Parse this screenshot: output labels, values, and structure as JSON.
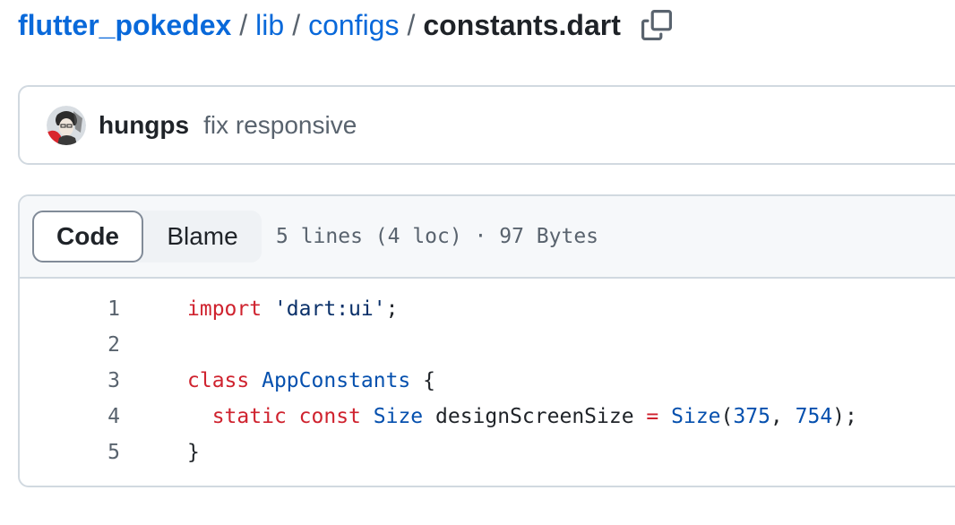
{
  "breadcrumb": {
    "repo": "flutter_pokedex",
    "sep": "/",
    "dir1": "lib",
    "dir2": "configs",
    "file": "constants.dart"
  },
  "icons": {
    "copy_path": "copy-icon",
    "avatar": "avatar-image"
  },
  "commit": {
    "author": "hungps",
    "message": "fix responsive"
  },
  "file_header": {
    "tabs": [
      {
        "label": "Code",
        "active": true
      },
      {
        "label": "Blame",
        "active": false
      }
    ],
    "meta": "5 lines (4 loc) · 97 Bytes"
  },
  "code": {
    "lines": [
      {
        "num": "1",
        "tokens": [
          {
            "t": "import",
            "c": "k"
          },
          {
            "t": " ",
            "c": "p"
          },
          {
            "t": "'dart:ui'",
            "c": "s"
          },
          {
            "t": ";",
            "c": "p"
          }
        ]
      },
      {
        "num": "2",
        "tokens": []
      },
      {
        "num": "3",
        "tokens": [
          {
            "t": "class",
            "c": "k"
          },
          {
            "t": " ",
            "c": "p"
          },
          {
            "t": "AppConstants",
            "c": "t"
          },
          {
            "t": " {",
            "c": "p"
          }
        ]
      },
      {
        "num": "4",
        "tokens": [
          {
            "t": "  ",
            "c": "p"
          },
          {
            "t": "static",
            "c": "k"
          },
          {
            "t": " ",
            "c": "p"
          },
          {
            "t": "const",
            "c": "k"
          },
          {
            "t": " ",
            "c": "p"
          },
          {
            "t": "Size",
            "c": "t"
          },
          {
            "t": " designScreenSize ",
            "c": "p"
          },
          {
            "t": "=",
            "c": "k"
          },
          {
            "t": " ",
            "c": "p"
          },
          {
            "t": "Size",
            "c": "t"
          },
          {
            "t": "(",
            "c": "p"
          },
          {
            "t": "375",
            "c": "n"
          },
          {
            "t": ", ",
            "c": "p"
          },
          {
            "t": "754",
            "c": "n"
          },
          {
            "t": ");",
            "c": "p"
          }
        ]
      },
      {
        "num": "5",
        "tokens": [
          {
            "t": "}",
            "c": "p"
          }
        ]
      }
    ]
  },
  "colors": {
    "link": "#0969da",
    "keyword": "#cf222e",
    "string": "#0a3069",
    "type": "#0550ae",
    "border": "#d1d9e0",
    "muted": "#59636e"
  }
}
